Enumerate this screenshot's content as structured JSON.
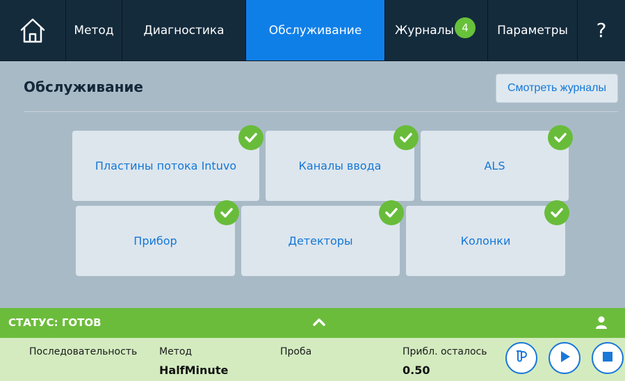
{
  "nav": {
    "home_icon": "home-icon",
    "tabs": [
      {
        "label": "Метод"
      },
      {
        "label": "Диагностика"
      },
      {
        "label": "Обслуживание",
        "active": true
      },
      {
        "label": "Журналы",
        "badge": "4"
      },
      {
        "label": "Параметры"
      }
    ],
    "help_label": "?"
  },
  "main": {
    "title": "Обслуживание",
    "view_logs_label": "Смотреть журналы",
    "tiles": [
      {
        "label": "Пластины потока Intuvo",
        "status": "ok"
      },
      {
        "label": "Каналы ввода",
        "status": "ok"
      },
      {
        "label": "ALS",
        "status": "ok"
      },
      {
        "label": "Прибор",
        "status": "ok"
      },
      {
        "label": "Детекторы",
        "status": "ok"
      },
      {
        "label": "Колонки",
        "status": "ok"
      }
    ]
  },
  "status": {
    "label": "СТАТУС: ГОТОВ",
    "color": "#6cbc3c",
    "sequence_label": "Последовательность",
    "method_label": "Метод",
    "method_value": "HalfMinute",
    "sample_label": "Проба",
    "remaining_label": "Прибл. осталось",
    "remaining_value": "0.50"
  },
  "colors": {
    "nav_bg": "#142b3c",
    "active_tab": "#0f7fe8",
    "accent": "#1477d6",
    "ok_green": "#68bc3a",
    "panel_bg": "#a9bac7"
  }
}
